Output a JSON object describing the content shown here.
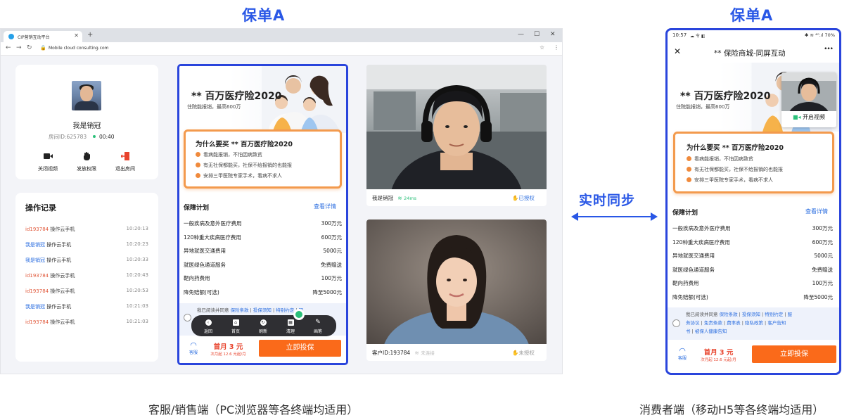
{
  "labels": {
    "left_title": "保单A",
    "right_title": "保单A",
    "left_caption": "客服/销售端（PC浏览器等各终端均适用）",
    "right_caption": "消费者端（移动H5等各终端均适用）",
    "sync": "实时同步"
  },
  "browser": {
    "tab_title": "CIP营销互动平台",
    "tab_close": "✕",
    "new_tab": "+",
    "url": "Mobile cloud consulting.com",
    "win_min": "—",
    "win_max": "☐",
    "win_close": "✕"
  },
  "agent": {
    "name": "我是销冠",
    "room_id": "房间ID:625783",
    "timer": "00:40",
    "controls": [
      {
        "label": "关闭视频",
        "icon": "video-camera-icon"
      },
      {
        "label": "发放权限",
        "icon": "hand-icon"
      },
      {
        "label": "退出房间",
        "icon": "exit-icon"
      }
    ]
  },
  "log": {
    "title": "操作记录",
    "rows": [
      {
        "who": "id193784",
        "action": "操作云手机",
        "time": "10:20:13",
        "color": "#e15a3c"
      },
      {
        "who": "我是销冠",
        "action": "操作云手机",
        "time": "10:20:23",
        "color": "#2d6fe0"
      },
      {
        "who": "我是销冠",
        "action": "操作云手机",
        "time": "10:20:33",
        "color": "#2d6fe0"
      },
      {
        "who": "id193784",
        "action": "操作云手机",
        "time": "10:20:43",
        "color": "#e15a3c"
      },
      {
        "who": "id193784",
        "action": "操作云手机",
        "time": "10:20:53",
        "color": "#e15a3c"
      },
      {
        "who": "我是销冠",
        "action": "操作云手机",
        "time": "10:21:03",
        "color": "#2d6fe0"
      },
      {
        "who": "id193784",
        "action": "操作云手机",
        "time": "10:21:03",
        "color": "#e15a3c"
      }
    ]
  },
  "policy": {
    "title": "** 百万医疗险2020",
    "subtitle": "住院能报销，最高600万",
    "why_title": "为什么要买 ** 百万医疗险2020",
    "why_items": [
      "看病能报销，不怕因病致贫",
      "有无社保都能买，社保不给报销的也能报",
      "安排三甲医院专家手术，看病不求人"
    ],
    "plan_title": "保障计划",
    "plan_link": "查看详情",
    "plan_rows": [
      {
        "name": "一般疾病及意外医疗费用",
        "value": "300万元"
      },
      {
        "name": "120种重大疾病医疗费用",
        "value": "600万元"
      },
      {
        "name": "异地就医交通费用",
        "value": "5000元"
      },
      {
        "name": "就医绿色通道服务",
        "value": "免费赠送"
      },
      {
        "name": "靶向药费用",
        "value": "100万元"
      },
      {
        "name": "降免赔额(可选)",
        "value": "降至5000元"
      }
    ],
    "terms_pc_prefix": "我已阅读并同意",
    "terms_pc_links": [
      "保险条款",
      "投保须知",
      "特别约定",
      "服"
    ],
    "terms_mobile_prefix": "我已阅读并同意",
    "terms_mobile_line1": [
      "保险条款",
      "投保须知",
      "特别约定",
      "服"
    ],
    "terms_mobile_line2": [
      "务协议",
      "免责条款",
      "费率表",
      "隐私政策",
      "客户告知"
    ],
    "terms_mobile_line3": [
      "书",
      "被保人健康告知"
    ],
    "service": "客服",
    "price": "首月 3 元",
    "price_sub": "次月起 12.6 元起/月",
    "buy": "立即投保"
  },
  "toolbar": {
    "items": [
      {
        "label": "返回",
        "icon": "back-icon"
      },
      {
        "label": "首页",
        "icon": "home-icon"
      },
      {
        "label": "刷新",
        "icon": "refresh-icon"
      },
      {
        "label": "清理",
        "icon": "clean-icon"
      },
      {
        "label": "画笔",
        "icon": "pen-icon"
      }
    ]
  },
  "videos": {
    "agent_name": "我是销冠",
    "agent_latency": "24ms",
    "agent_auth": "已授权",
    "customer_id": "客户ID:193784",
    "customer_conn": "未连接",
    "customer_auth": "未授权"
  },
  "mobile": {
    "time": "10:57",
    "status_icons": "☁ 令 ◧",
    "status_right": "✱ ≋ ⁴ᴳ.ıl 70%",
    "title": "** 保险商城-同屏互动",
    "close": "✕",
    "more": "•••",
    "open_video": "开启视频"
  },
  "colors": {
    "accent_blue": "#2957e6",
    "frame_blue": "#2a45dc",
    "orange": "#fa6a1a",
    "green": "#2bc07a"
  }
}
